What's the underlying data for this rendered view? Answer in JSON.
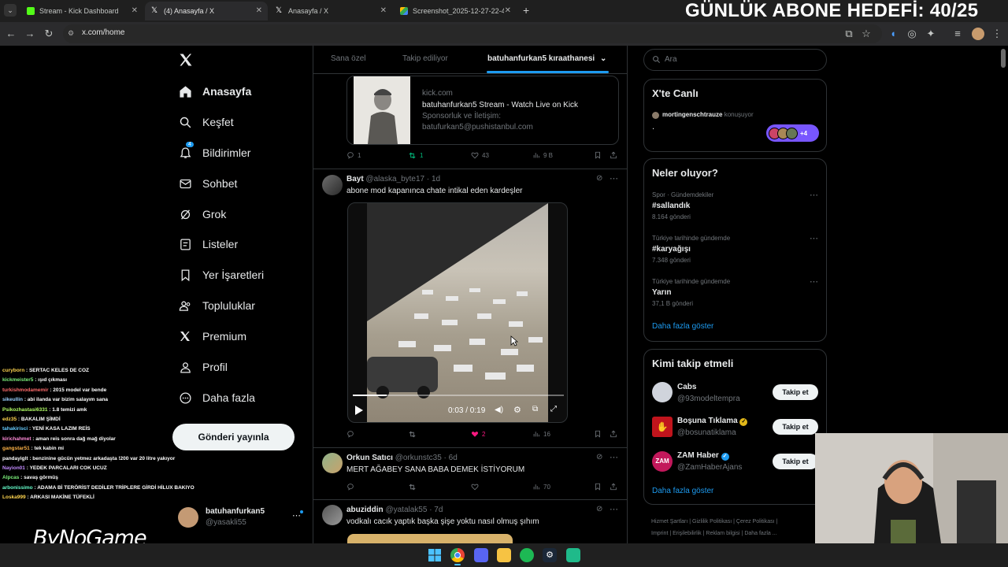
{
  "browser": {
    "tabs": [
      {
        "title": "Stream - Kick Dashboard"
      },
      {
        "title": "(4) Anasayfa / X"
      },
      {
        "title": "Anasayfa / X"
      },
      {
        "title": "Screenshot_2025-12-27-22-49-..."
      }
    ],
    "url": "x.com/home"
  },
  "overlay": {
    "goal_text": "GÜNLÜK ABONE HEDEFİ: 40/25",
    "watermark": "ByNoGame"
  },
  "sidebar": {
    "items": [
      {
        "label": "Anasayfa",
        "icon": "home-icon"
      },
      {
        "label": "Keşfet",
        "icon": "search-icon"
      },
      {
        "label": "Bildirimler",
        "icon": "bell-icon",
        "badge": "4"
      },
      {
        "label": "Sohbet",
        "icon": "mail-icon"
      },
      {
        "label": "Grok",
        "icon": "grok-icon"
      },
      {
        "label": "Listeler",
        "icon": "list-icon"
      },
      {
        "label": "Yer İşaretleri",
        "icon": "bookmark-icon"
      },
      {
        "label": "Topluluklar",
        "icon": "community-icon"
      },
      {
        "label": "Premium",
        "icon": "x-logo-icon"
      },
      {
        "label": "Profil",
        "icon": "person-icon"
      },
      {
        "label": "Daha fazla",
        "icon": "more-circle-icon"
      }
    ],
    "post_button": "Gönderi yayınla",
    "account": {
      "name": "batuhanfurkan5",
      "handle": "@yasakli55"
    }
  },
  "timeline": {
    "tabs": [
      "Sana özel",
      "Takip ediliyor",
      "batuhanfurkan5 kıraathanesi"
    ],
    "link_card": {
      "domain": "kick.com",
      "title": "batuhanfurkan5 Stream - Watch Live on Kick",
      "desc_line1": "Sponsorluk ve İletişim:",
      "desc_line2": "batufurkan5@pushistanbul.com"
    },
    "post0_actions": {
      "replies": "1",
      "reposts": "1",
      "likes": "43",
      "views": "9 B"
    },
    "posts": [
      {
        "name": "Bayt",
        "handle": "@alaska_byte17 · 1d",
        "text": "abone mod kapanınca chate intikal eden kardeşler",
        "video_time": "0:03 / 0:19",
        "video_progress": 0.16,
        "replies": "",
        "reposts": "",
        "likes": "2",
        "views": "16"
      },
      {
        "name": "Orkun Satıcı",
        "handle": "@orkunstc35 · 6d",
        "text": "MERT AĞABEY SANA BABA DEMEK İSTİYORUM",
        "views": "70"
      },
      {
        "name": "abuziddin",
        "handle": "@yatalak55 · 7d",
        "text": "vodkalı cacık yaptık başka şişe yoktu nasıl olmuş şıhım"
      }
    ]
  },
  "right": {
    "search_placeholder": "Ara",
    "live": {
      "title": "X'te Canlı",
      "host": "mortingenschtrauze",
      "host_suffix": "konuşuyor",
      "dot": ".",
      "extra_count": "+4"
    },
    "trends": {
      "title": "Neler oluyor?",
      "items": [
        {
          "meta": "Spor · Gündemdekiler",
          "name": "#sallandık",
          "count": "8.164 gönderi"
        },
        {
          "meta": "Türkiye tarihinde gündemde",
          "name": "#karyağışı",
          "count": "7.348 gönderi"
        },
        {
          "meta": "Türkiye tarihinde gündemde",
          "name": "Yarın",
          "count": "37,1 B gönderi"
        }
      ],
      "show_more": "Daha fazla göster"
    },
    "who_to_follow": {
      "title": "Kimi takip etmeli",
      "items": [
        {
          "name": "Cabs",
          "handle": "@93modeltempra",
          "button": "Takip et"
        },
        {
          "name": "Boşuna Tıklama",
          "handle": "@bosunatiklama",
          "button": "Takip et"
        },
        {
          "name": "ZAM Haber",
          "handle": "@ZamHaberAjans",
          "button": "Takip et"
        }
      ],
      "show_more": "Daha fazla göster"
    },
    "footer": [
      "Hizmet Şartları",
      "Gizlilik Politikası",
      "Çerez Politikası",
      "Imprint",
      "Erişilebilirlik",
      "Reklam bilgisi",
      "Daha fazla ..."
    ]
  },
  "chat": [
    {
      "user": "curyborn",
      "msg": "SERTAC KELES DE COZ",
      "color": "#ffd54f"
    },
    {
      "user": "kickmeister5",
      "msg": "ışıd çıkması",
      "color": "#7cf07c"
    },
    {
      "user": "turkishmodamemir",
      "msg": "2015 model var bende",
      "color": "#ff6b6b"
    },
    {
      "user": "sikeullin",
      "msg": "abi ilanda var bizim salayım sana",
      "color": "#9ad0ff"
    },
    {
      "user": "Psikozhastasi6331",
      "msg": "1.8 temizi amk",
      "color": "#b3ff66"
    },
    {
      "user": "edz35",
      "msg": "BAKALIM ŞİMDİ",
      "color": "#ffd54f"
    },
    {
      "user": "tahakirisci",
      "msg": "YENİ KASA LAZIM REİS",
      "color": "#66ccff"
    },
    {
      "user": "kirichahmet",
      "msg": "aman reis sonra dağ mağ diyolar",
      "color": "#ff8ad8"
    },
    {
      "user": "gangstar51",
      "msg": "tek kabin mi",
      "color": "#ffb347"
    },
    {
      "user": "pandayiglt",
      "msg": "benzinine gücün yetmez arkadaşta !200 var 20 litre yakıyor",
      "color": "#ffffff"
    },
    {
      "user": "Nayion01",
      "msg": "YEDEK PARCALARI COK UCUZ",
      "color": "#c38bff"
    },
    {
      "user": "Alpcas",
      "msg": "savaş görmüş",
      "color": "#7cf07c"
    },
    {
      "user": "arbonissimo",
      "msg": "ADAMA Bİ TERÖRİST DEDİLER TRİPLERE GİRDİ HİLUX BAKIYO",
      "color": "#66ffcc"
    },
    {
      "user": "Loska999",
      "msg": "ARKASI MAKİNE TÜFEKLİ",
      "color": "#ffd54f"
    }
  ]
}
